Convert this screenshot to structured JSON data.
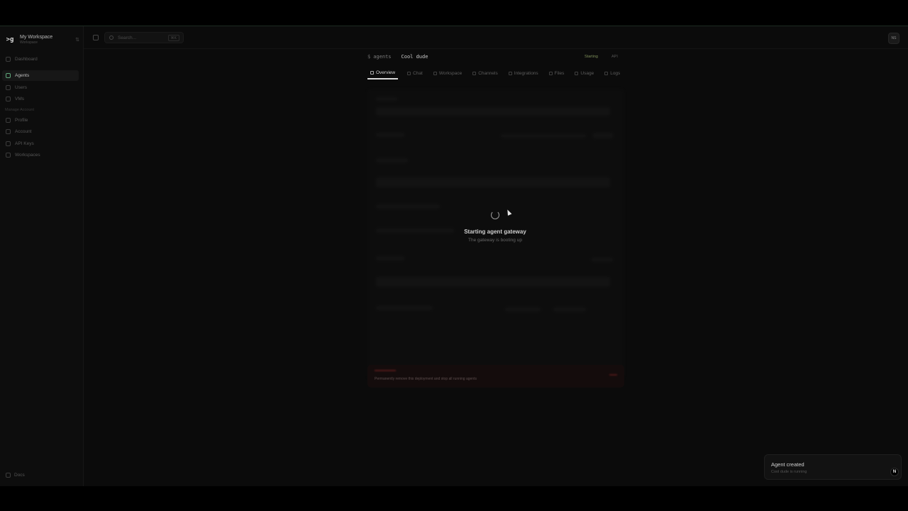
{
  "workspace": {
    "logo": ">g",
    "name": "My Workspace",
    "subtitle": "Workspace",
    "chevron": "⇅"
  },
  "sidebar": {
    "items": [
      {
        "label": "Dashboard",
        "icon": "dashboard-icon"
      },
      {
        "label": "Agents",
        "icon": "agents-icon",
        "active": true
      },
      {
        "label": "Users",
        "icon": "users-icon"
      },
      {
        "label": "VMs",
        "icon": "server-icon"
      }
    ],
    "section_label": "Manage Account",
    "account_items": [
      {
        "label": "Profile",
        "icon": "user-icon"
      },
      {
        "label": "Account",
        "icon": "account-icon"
      },
      {
        "label": "API Keys",
        "icon": "key-icon"
      },
      {
        "label": "Workspaces",
        "icon": "layers-icon"
      }
    ],
    "docs_label": "Docs"
  },
  "topbar": {
    "search_placeholder": "Search...",
    "shortcut": "⌘K",
    "avatar_initials": "NS"
  },
  "header": {
    "dollar": "$",
    "breadcrumb_root": "agents",
    "agent_name": "Cool dude",
    "status": "Starting",
    "api_label": "API"
  },
  "tabs": [
    {
      "label": "Overview",
      "active": true
    },
    {
      "label": "Chat"
    },
    {
      "label": "Workspace"
    },
    {
      "label": "Channels"
    },
    {
      "label": "Integrations"
    },
    {
      "label": "Files"
    },
    {
      "label": "Usage"
    },
    {
      "label": "Logs"
    }
  ],
  "danger_zone": {
    "description": "Permanently remove this deployment and stop all running agents"
  },
  "loading": {
    "title": "Starting agent gateway",
    "subtitle": "The gateway is booting up"
  },
  "toast": {
    "title": "Agent created",
    "description": "Cool dude is running",
    "badge": "N"
  },
  "colors": {
    "accent": "#5fa77b",
    "status": "#7e8f5a",
    "background": "#0b0b0b"
  }
}
